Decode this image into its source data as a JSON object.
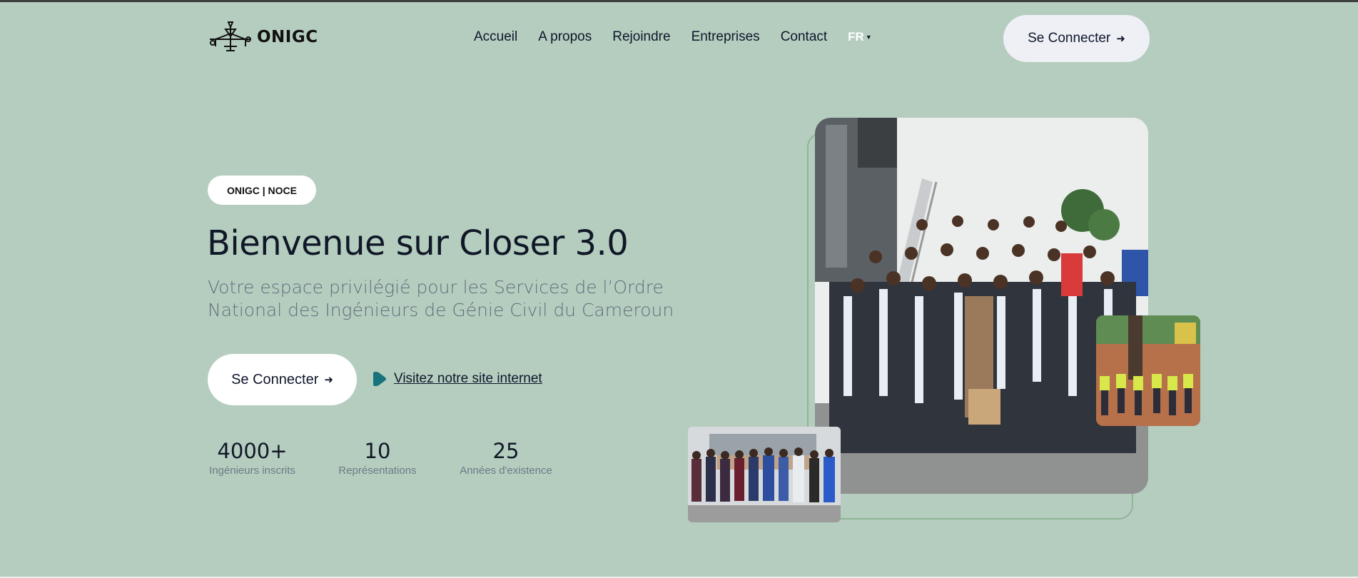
{
  "header": {
    "logo_text": "ONIGC",
    "nav": [
      {
        "label": "Accueil"
      },
      {
        "label": "A propos"
      },
      {
        "label": "Rejoindre"
      },
      {
        "label": "Entreprises"
      },
      {
        "label": "Contact"
      }
    ],
    "language": "FR",
    "login_label": "Se Connecter",
    "arrow_icon": "arrow-right-icon"
  },
  "hero": {
    "badge": "ONIGC | NOCE",
    "title": "Bienvenue sur Closer 3.0",
    "subtitle": "Votre espace privilégié pour les Services de l’Ordre National des Ingénieurs de Génie Civil du Cameroun",
    "login_label": "Se Connecter",
    "visit_label": "Visitez notre site internet",
    "visit_icon": "play-icon"
  },
  "stats": [
    {
      "value": "4000+",
      "label": "Ingénieurs inscrits"
    },
    {
      "value": "10",
      "label": "Représentations"
    },
    {
      "value": "25",
      "label": "Années d'existence"
    }
  ],
  "colors": {
    "background": "#b5cdbf",
    "accent": "#17747d",
    "frame_line": "#8fb597"
  }
}
